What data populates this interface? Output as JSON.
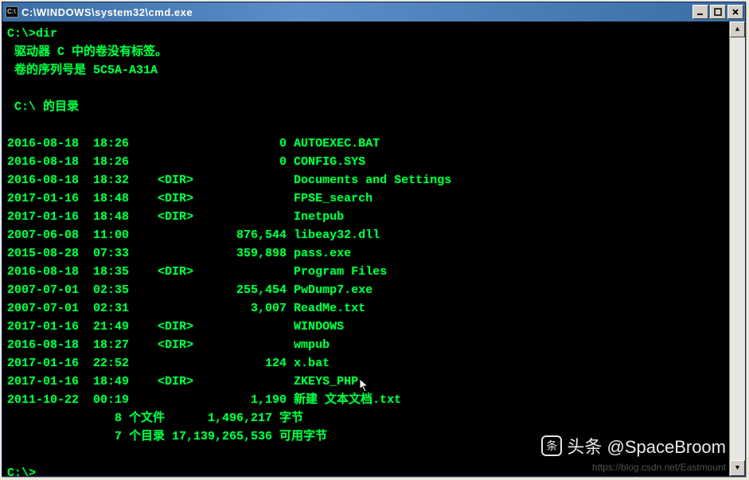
{
  "window": {
    "icon_label": "C:\\",
    "title": "C:\\WINDOWS\\system32\\cmd.exe"
  },
  "prompt1": "C:\\>",
  "command": "dir",
  "line_volume_nolabel": " 驱动器 C 中的卷没有标签。",
  "line_serial_prefix": " 卷的序列号是 ",
  "serial": "5C5A-A31A",
  "line_dirof": " C:\\ 的目录",
  "rows": [
    {
      "date": "2016-08-18",
      "time": "18:26",
      "dir": "",
      "size": "0",
      "name": "AUTOEXEC.BAT"
    },
    {
      "date": "2016-08-18",
      "time": "18:26",
      "dir": "",
      "size": "0",
      "name": "CONFIG.SYS"
    },
    {
      "date": "2016-08-18",
      "time": "18:32",
      "dir": "<DIR>",
      "size": "",
      "name": "Documents and Settings"
    },
    {
      "date": "2017-01-16",
      "time": "18:48",
      "dir": "<DIR>",
      "size": "",
      "name": "FPSE_search"
    },
    {
      "date": "2017-01-16",
      "time": "18:48",
      "dir": "<DIR>",
      "size": "",
      "name": "Inetpub"
    },
    {
      "date": "2007-06-08",
      "time": "11:00",
      "dir": "",
      "size": "876,544",
      "name": "libeay32.dll"
    },
    {
      "date": "2015-08-28",
      "time": "07:33",
      "dir": "",
      "size": "359,898",
      "name": "pass.exe"
    },
    {
      "date": "2016-08-18",
      "time": "18:35",
      "dir": "<DIR>",
      "size": "",
      "name": "Program Files"
    },
    {
      "date": "2007-07-01",
      "time": "02:35",
      "dir": "",
      "size": "255,454",
      "name": "PwDump7.exe"
    },
    {
      "date": "2007-07-01",
      "time": "02:31",
      "dir": "",
      "size": "3,007",
      "name": "ReadMe.txt"
    },
    {
      "date": "2017-01-16",
      "time": "21:49",
      "dir": "<DIR>",
      "size": "",
      "name": "WINDOWS"
    },
    {
      "date": "2016-08-18",
      "time": "18:27",
      "dir": "<DIR>",
      "size": "",
      "name": "wmpub"
    },
    {
      "date": "2017-01-16",
      "time": "22:52",
      "dir": "",
      "size": "124",
      "name": "x.bat"
    },
    {
      "date": "2017-01-16",
      "time": "18:49",
      "dir": "<DIR>",
      "size": "",
      "name": "ZKEYS_PHP"
    },
    {
      "date": "2011-10-22",
      "time": "00:19",
      "dir": "",
      "size": "1,190",
      "name": "新建 文本文档.txt"
    }
  ],
  "summary": {
    "file_count": "8",
    "file_label": "个文件",
    "file_bytes": "1,496,217",
    "bytes_label": "字节",
    "dir_count": "7",
    "dir_label": "个目录",
    "free_bytes": "17,139,265,536",
    "free_label": "可用字节"
  },
  "prompt2": "C:\\>",
  "watermark1": "头条 @SpaceBroom",
  "watermark2": "https://blog.csdn.net/Eastmount"
}
